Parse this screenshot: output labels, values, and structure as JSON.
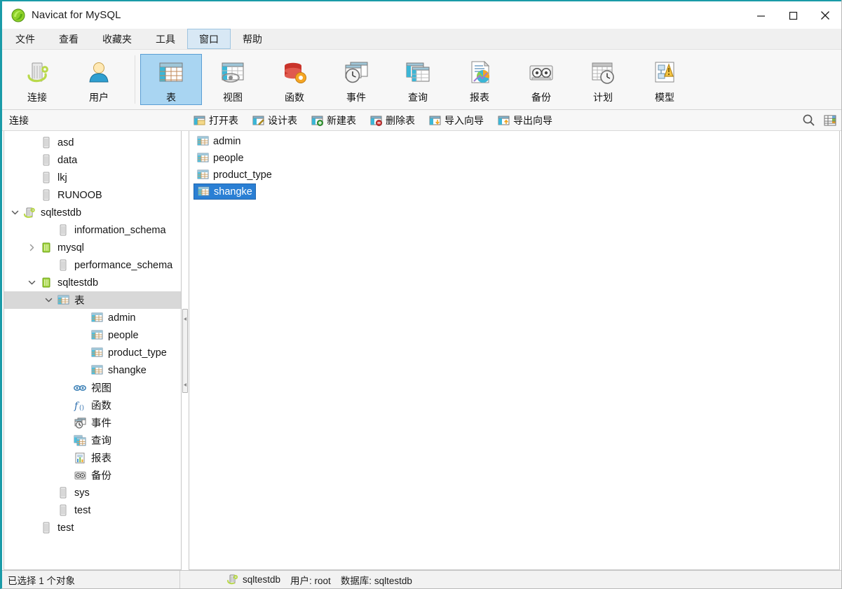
{
  "window": {
    "title": "Navicat for MySQL",
    "logo_icon": "navicat-logo-icon",
    "minimize_icon": "minimize-icon",
    "maximize_icon": "maximize-icon",
    "close_icon": "close-icon"
  },
  "menubar": {
    "items": [
      {
        "label": "文件",
        "name": "menu-file",
        "active": false
      },
      {
        "label": "查看",
        "name": "menu-view",
        "active": false
      },
      {
        "label": "收藏夹",
        "name": "menu-favorites",
        "active": false
      },
      {
        "label": "工具",
        "name": "menu-tools",
        "active": false
      },
      {
        "label": "窗口",
        "name": "menu-window",
        "active": true
      },
      {
        "label": "帮助",
        "name": "menu-help",
        "active": false
      }
    ]
  },
  "toolbar": {
    "group1": [
      {
        "label": "连接",
        "icon": "connection-icon"
      },
      {
        "label": "用户",
        "icon": "user-icon"
      }
    ],
    "group2": [
      {
        "label": "表",
        "icon": "table-icon",
        "selected": true
      },
      {
        "label": "视图",
        "icon": "view-icon",
        "selected": false
      },
      {
        "label": "函数",
        "icon": "function-icon",
        "selected": false
      },
      {
        "label": "事件",
        "icon": "event-icon",
        "selected": false
      },
      {
        "label": "查询",
        "icon": "query-icon",
        "selected": false
      },
      {
        "label": "报表",
        "icon": "report-icon",
        "selected": false
      },
      {
        "label": "备份",
        "icon": "backup-icon",
        "selected": false
      },
      {
        "label": "计划",
        "icon": "schedule-icon",
        "selected": false
      },
      {
        "label": "模型",
        "icon": "model-icon",
        "selected": false
      }
    ]
  },
  "connection_panel": {
    "header": "连接"
  },
  "object_toolbar": {
    "buttons": [
      {
        "label": "打开表",
        "icon": "open-table-icon"
      },
      {
        "label": "设计表",
        "icon": "design-table-icon"
      },
      {
        "label": "新建表",
        "icon": "new-table-icon"
      },
      {
        "label": "删除表",
        "icon": "delete-table-icon"
      },
      {
        "label": "导入向导",
        "icon": "import-wizard-icon"
      },
      {
        "label": "导出向导",
        "icon": "export-wizard-icon"
      }
    ],
    "right_icons": [
      {
        "name": "search-icon"
      },
      {
        "name": "grid-view-icon"
      }
    ]
  },
  "tree": {
    "nodes": [
      {
        "label": "asd",
        "indent": 1,
        "icon": "db-grey-icon",
        "twisty": "",
        "selected": false
      },
      {
        "label": "data",
        "indent": 1,
        "icon": "db-grey-icon",
        "twisty": "",
        "selected": false
      },
      {
        "label": "lkj",
        "indent": 1,
        "icon": "db-grey-icon",
        "twisty": "",
        "selected": false
      },
      {
        "label": "RUNOOB",
        "indent": 1,
        "icon": "db-grey-icon",
        "twisty": "",
        "selected": false
      },
      {
        "label": "sqltestdb",
        "indent": 0,
        "icon": "connection-green-icon",
        "twisty": "down",
        "selected": false
      },
      {
        "label": "information_schema",
        "indent": 2,
        "icon": "db-grey-icon",
        "twisty": "",
        "selected": false
      },
      {
        "label": "mysql",
        "indent": 1,
        "icon": "db-green-icon",
        "twisty": "right",
        "selected": false
      },
      {
        "label": "performance_schema",
        "indent": 2,
        "icon": "db-grey-icon",
        "twisty": "",
        "selected": false
      },
      {
        "label": "sqltestdb",
        "indent": 1,
        "icon": "db-green-icon",
        "twisty": "down",
        "selected": false
      },
      {
        "label": "表",
        "indent": 2,
        "icon": "table-node-icon",
        "twisty": "down",
        "selected": true
      },
      {
        "label": "admin",
        "indent": 4,
        "icon": "table-node-icon",
        "twisty": "",
        "selected": false
      },
      {
        "label": "people",
        "indent": 4,
        "icon": "table-node-icon",
        "twisty": "",
        "selected": false
      },
      {
        "label": "product_type",
        "indent": 4,
        "icon": "table-node-icon",
        "twisty": "",
        "selected": false
      },
      {
        "label": "shangke",
        "indent": 4,
        "icon": "table-node-icon",
        "twisty": "",
        "selected": false
      },
      {
        "label": "视图",
        "indent": 3,
        "icon": "view-node-icon",
        "twisty": "",
        "selected": false
      },
      {
        "label": "函数",
        "indent": 3,
        "icon": "function-node-icon",
        "twisty": "",
        "selected": false
      },
      {
        "label": "事件",
        "indent": 3,
        "icon": "event-node-icon",
        "twisty": "",
        "selected": false
      },
      {
        "label": "查询",
        "indent": 3,
        "icon": "query-node-icon",
        "twisty": "",
        "selected": false
      },
      {
        "label": "报表",
        "indent": 3,
        "icon": "report-node-icon",
        "twisty": "",
        "selected": false
      },
      {
        "label": "备份",
        "indent": 3,
        "icon": "backup-node-icon",
        "twisty": "",
        "selected": false
      },
      {
        "label": "sys",
        "indent": 2,
        "icon": "db-grey-icon",
        "twisty": "",
        "selected": false
      },
      {
        "label": "test",
        "indent": 2,
        "icon": "db-grey-icon",
        "twisty": "",
        "selected": false
      },
      {
        "label": "test",
        "indent": 1,
        "icon": "db-grey-icon",
        "twisty": "",
        "selected": false
      }
    ]
  },
  "object_list": {
    "items": [
      {
        "label": "admin",
        "icon": "table-item-icon",
        "selected": false
      },
      {
        "label": "people",
        "icon": "table-item-icon",
        "selected": false
      },
      {
        "label": "product_type",
        "icon": "table-item-icon",
        "selected": false
      },
      {
        "label": "shangke",
        "icon": "table-item-icon",
        "selected": true
      }
    ]
  },
  "statusbar": {
    "selection_text": "已选择 1 个对象",
    "connection_icon": "connection-green-icon",
    "connection_name": "sqltestdb",
    "user_label": "用户: root",
    "database_label": "数据库: sqltestdb"
  },
  "colors": {
    "accent_teal": "#1a9ba8",
    "selected_blue": "#2a7fd4",
    "toolbar_selected": "#a9d5f2",
    "menu_active": "#d8e8f5",
    "tree_selected": "#d8d8d8"
  }
}
